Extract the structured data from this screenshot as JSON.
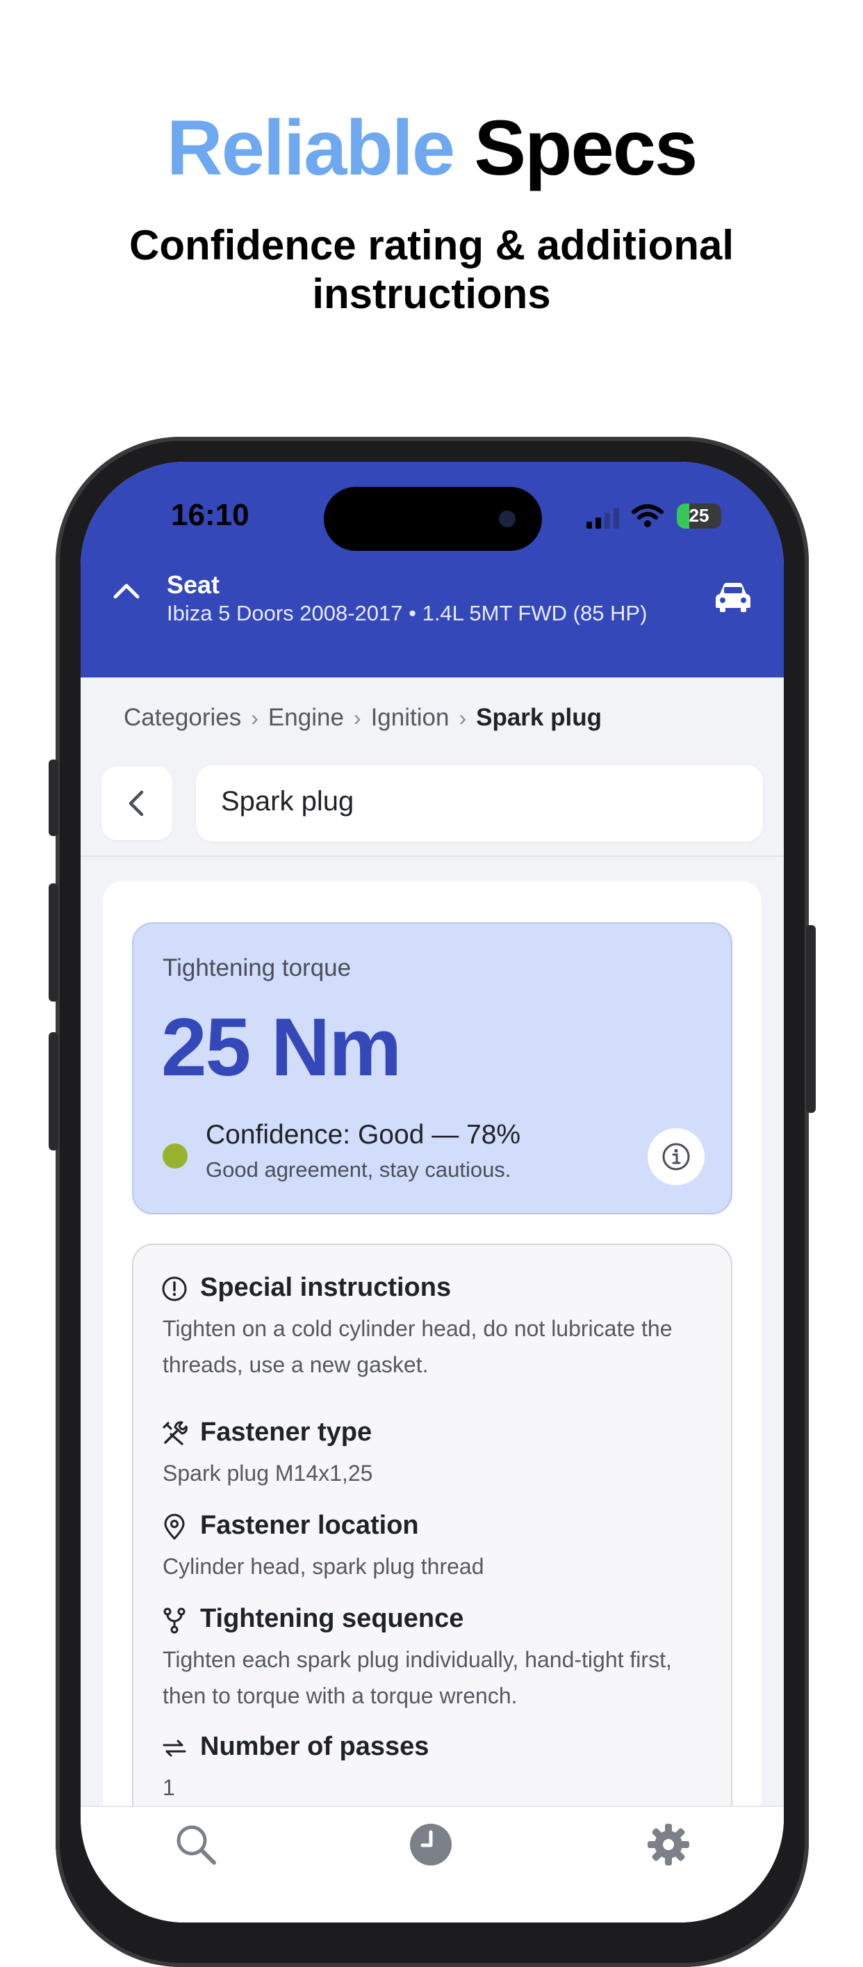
{
  "promo": {
    "headline_accent": "Reliable",
    "headline_rest": "Specs",
    "subtitle_line1": "Confidence rating & additional",
    "subtitle_line2": "instructions",
    "accent_color": "#6ea8f0"
  },
  "status_bar": {
    "time": "16:10",
    "battery": "25"
  },
  "vehicle": {
    "make": "Seat",
    "model": "Ibiza 5 Doors 2008-2017 • 1.4L 5MT FWD (85 HP)",
    "brand_color": "#3448b9"
  },
  "breadcrumb": {
    "items": [
      "Categories",
      "Engine",
      "Ignition"
    ],
    "current": "Spark plug",
    "separator": "›"
  },
  "search": {
    "value": "Spark plug"
  },
  "torque": {
    "label": "Tightening torque",
    "value": "25 Nm",
    "confidence_title": "Confidence: Good — 78%",
    "confidence_note": "Good agreement, stay cautious.",
    "confidence_color": "#97b32e"
  },
  "details": {
    "special_instructions": {
      "title": "Special instructions",
      "text": "Tighten on a cold cylinder head, do not lubricate the threads, use a new gasket.",
      "icon": "alert-circle-icon"
    },
    "fastener_type": {
      "title": "Fastener type",
      "text": "Spark plug M14x1,25",
      "icon": "tools-icon"
    },
    "fastener_location": {
      "title": "Fastener location",
      "text": "Cylinder head, spark plug thread",
      "icon": "map-pin-icon"
    },
    "tightening_sequence": {
      "title": "Tightening sequence",
      "text": "Tighten each spark plug individually, hand-tight first, then to torque with a torque wrench.",
      "icon": "fork-icon"
    },
    "number_of_passes": {
      "title": "Number of passes",
      "text": "1",
      "icon": "repeat-icon"
    }
  },
  "tabbar": {
    "tabs": [
      "search-icon",
      "history-icon",
      "settings-icon"
    ]
  }
}
